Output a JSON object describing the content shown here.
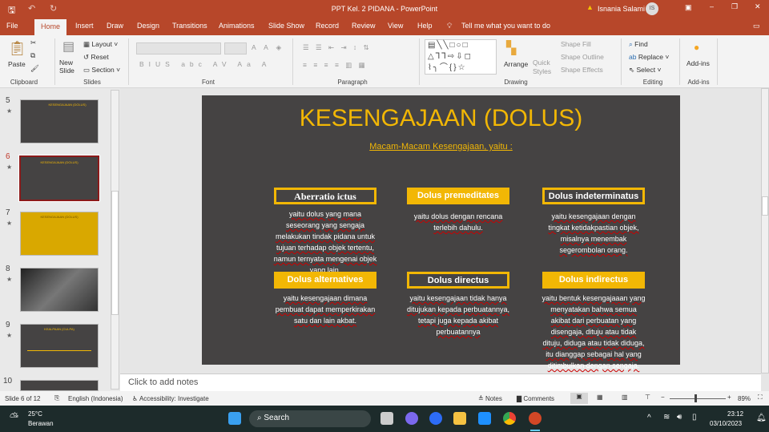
{
  "window": {
    "title": "PPT Kel. 2 PIDANA  -  PowerPoint",
    "user": "Isnania Salami",
    "user_initials": "IS"
  },
  "tabs": [
    "File",
    "Home",
    "Insert",
    "Draw",
    "Design",
    "Transitions",
    "Animations",
    "Slide Show",
    "Record",
    "Review",
    "View",
    "Help"
  ],
  "tell_me": "Tell me what you want to do",
  "ribbon": {
    "clipboard": {
      "paste": "Paste",
      "label": "Clipboard"
    },
    "slides": {
      "new_slide": "New Slide",
      "layout": "Layout",
      "reset": "Reset",
      "section": "Section",
      "label": "Slides"
    },
    "font": {
      "label": "Font"
    },
    "paragraph": {
      "label": "Paragraph"
    },
    "drawing": {
      "arrange": "Arrange",
      "quick_styles": "Quick Styles",
      "shape_fill": "Shape Fill",
      "shape_outline": "Shape Outline",
      "shape_effects": "Shape Effects",
      "label": "Drawing"
    },
    "editing": {
      "find": "Find",
      "replace": "Replace",
      "select": "Select",
      "label": "Editing"
    },
    "addins": {
      "button": "Add-ins",
      "label": "Add-ins"
    }
  },
  "thumbnails": [
    {
      "num": "5",
      "title": "KESENGAJAAN (DOLUS)"
    },
    {
      "num": "6",
      "title": "KESENGAJAAN (DOLUS)",
      "active": true
    },
    {
      "num": "7",
      "title": "KESENGAJAAN (DOLUS)"
    },
    {
      "num": "8",
      "title": ""
    },
    {
      "num": "9",
      "title": "KEALPAAN (CULPA)"
    },
    {
      "num": "10",
      "title": ""
    }
  ],
  "slide": {
    "title": "KESENGAJAAN (DOLUS)",
    "subtitle": "Macam-Macam Kesengajaan, yaitu :",
    "accent": "#f2b705",
    "items": [
      {
        "label": "Aberratio ictus",
        "style": "outline",
        "desc": "yaitu dolus yang mana seseorang yang sengaja melakukan tindak pidana untuk tujuan terhadap objek tertentu, namun ternyata mengenai objek yang lain."
      },
      {
        "label": "Dolus premeditates",
        "style": "filled",
        "desc": "yaitu dolus dengan rencana terlebih dahulu."
      },
      {
        "label": "Dolus indeterminatus",
        "style": "outline",
        "desc": "yaitu kesengajaan dengan tingkat ketidakpastian objek, misalnya menembak segerombolan orang."
      },
      {
        "label": "Dolus  alternatives",
        "style": "filled",
        "desc": "yaitu kesengajaan dimana pembuat dapat memperkirakan satu dan lain akbat."
      },
      {
        "label": "Dolus   directus",
        "style": "outline",
        "desc": "yaitu kesengajaan tidak hanya ditujukan kepada perbuatannya, tetapi juga kepada akibat perbuatannya"
      },
      {
        "label": "Dolus indirectus",
        "style": "filled",
        "desc": "yaitu bentuk kesengajaaan yang menyatakan bahwa semua akibat dari perbuatan yang disengaja, dituju atau tidak dituju, diduga atau tidak diduga, itu dianggap sebagai hal yang ditimbulkan dengan sengaja."
      }
    ]
  },
  "notes_placeholder": "Click to add notes",
  "status": {
    "slide": "Slide 6 of 12",
    "language": "English (Indonesia)",
    "accessibility": "Accessibility: Investigate",
    "notes": "Notes",
    "comments": "Comments",
    "zoom": "89%",
    "zoom_value": 89
  },
  "taskbar": {
    "temp": "25°C",
    "weather": "Berawan",
    "search": "Search",
    "time": "23:12",
    "date": "03/10/2023"
  }
}
